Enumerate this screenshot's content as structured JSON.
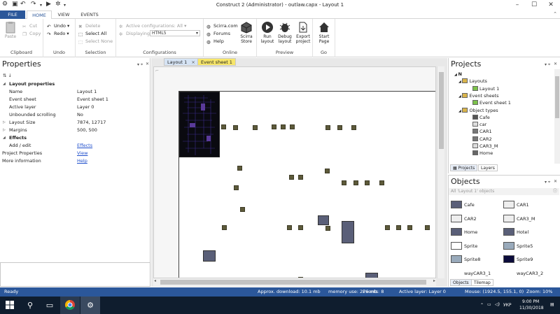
{
  "window": {
    "title": "Construct 2 (Administrator) - outlaw.capx - Layout 1",
    "minimize": "–",
    "maximize": "☐",
    "close": "✕"
  },
  "ribbon_tabs": {
    "file": "FILE",
    "home": "HOME",
    "view": "VIEW",
    "events": "EVENTS"
  },
  "ribbon": {
    "clipboard": {
      "label": "Clipboard",
      "paste": "Paste",
      "cut": "Cut",
      "copy": "Copy"
    },
    "undo": {
      "label": "Undo",
      "undo": "Undo",
      "redo": "Redo"
    },
    "selection": {
      "label": "Selection",
      "delete": "Delete",
      "select_all": "Select All",
      "select_none": "Select None"
    },
    "configurations": {
      "label": "Configurations",
      "active": "Active configurations: All",
      "displaying": "Displaying:",
      "displaying_value": "HTML5"
    },
    "online": {
      "label": "Online",
      "scirra": "Scirra.com",
      "forums": "Forums",
      "help": "Help",
      "store_line1": "Scirra",
      "store_line2": "Store"
    },
    "preview": {
      "label": "Preview",
      "run_line1": "Run",
      "run_line2": "layout",
      "debug_line1": "Debug",
      "debug_line2": "layout",
      "export_line1": "Export",
      "export_line2": "project"
    },
    "go": {
      "label": "Go",
      "start_line1": "Start",
      "start_line2": "Page"
    }
  },
  "properties": {
    "title": "Properties",
    "rows": [
      {
        "type": "cat",
        "key": "Layout properties"
      },
      {
        "key": "Name",
        "value": "Layout 1"
      },
      {
        "key": "Event sheet",
        "value": "Event sheet 1"
      },
      {
        "key": "Active layer",
        "value": "Layer 0"
      },
      {
        "key": "Unbounded scrolling",
        "value": "No"
      },
      {
        "key": "Layout Size",
        "value": "7874, 12717",
        "expand": true
      },
      {
        "key": "Margins",
        "value": "500, 500",
        "expand": true
      },
      {
        "type": "cat",
        "key": "Effects"
      },
      {
        "key": "Add / edit",
        "value": "Effects",
        "link": true
      },
      {
        "key": "Project Properties",
        "value": "View",
        "link": true,
        "outdent": true
      },
      {
        "key": "More information",
        "value": "Help",
        "link": true,
        "outdent": true
      }
    ]
  },
  "editor": {
    "tabs": {
      "layout": "Layout 1",
      "events": "Event sheet 1",
      "close": "×"
    }
  },
  "projects": {
    "title": "Projects",
    "tree": [
      {
        "label": "N",
        "bold": true
      },
      {
        "label": "Layouts"
      },
      {
        "label": "Layout 1"
      },
      {
        "label": "Event sheets"
      },
      {
        "label": "Event sheet 1"
      },
      {
        "label": "Object types"
      },
      {
        "label": "Cafe"
      },
      {
        "label": "car"
      },
      {
        "label": "CAR1"
      },
      {
        "label": "CAR2"
      },
      {
        "label": "CAR3_M"
      },
      {
        "label": "Home"
      }
    ],
    "tab_projects": "Projects",
    "tab_layers": "Layers"
  },
  "objects": {
    "title": "Objects",
    "filter": "All 'Layout 1' objects",
    "items": [
      {
        "label": "Cafe"
      },
      {
        "label": "CAR1"
      },
      {
        "label": "CAR2"
      },
      {
        "label": "CAR3_M"
      },
      {
        "label": "Home"
      },
      {
        "label": "Hotel"
      },
      {
        "label": "Sprite"
      },
      {
        "label": "Sprite5"
      },
      {
        "label": "Sprite8"
      },
      {
        "label": "Sprite9"
      },
      {
        "label": "wayCAR3_1"
      },
      {
        "label": "wayCAR3_2"
      }
    ],
    "tab_objects": "Objects",
    "tab_tilemap": "Tilemap"
  },
  "statusbar": {
    "ready": "Ready",
    "download": "Approx. download: 10.1 mb",
    "memory": "memory use: 226 mb",
    "events": "Events: 8",
    "layer": "Active layer: Layer 0",
    "mouse": "Mouse: (1924.5, 155.1, 0)",
    "zoom": "Zoom: 10%"
  },
  "taskbar": {
    "lang": "УКР",
    "time": "9:00 PM",
    "date": "11/30/2018"
  },
  "colors": {
    "accent": "#2b579a",
    "event_tab": "#f7e66a",
    "layout_tab": "#d6e4f5"
  }
}
